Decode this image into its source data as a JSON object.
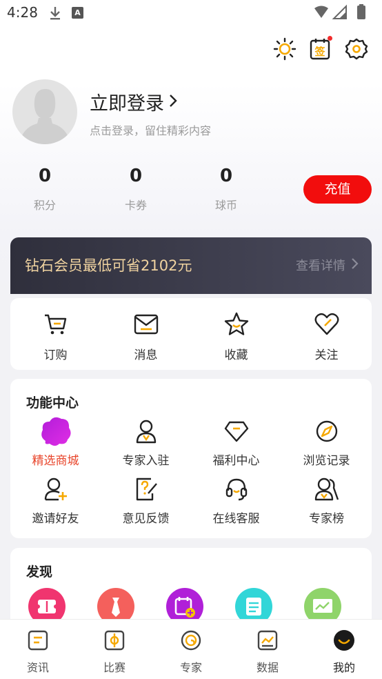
{
  "status_bar": {
    "time": "4:28",
    "a_label": "A"
  },
  "profile": {
    "login_title": "立即登录",
    "login_subtitle": "点击登录，留住精彩内容"
  },
  "sign_icon_label": "签",
  "stats": [
    {
      "value": "0",
      "label": "积分"
    },
    {
      "value": "0",
      "label": "卡券"
    },
    {
      "value": "0",
      "label": "球币"
    }
  ],
  "recharge_label": "充值",
  "vip": {
    "text": "钻石会员最低可省2102元",
    "more": "查看详情"
  },
  "quick_actions": [
    {
      "label": "订购",
      "icon": "cart-icon"
    },
    {
      "label": "消息",
      "icon": "mail-icon"
    },
    {
      "label": "收藏",
      "icon": "star-icon"
    },
    {
      "label": "关注",
      "icon": "heart-icon"
    }
  ],
  "function_center": {
    "title": "功能中心",
    "items": [
      {
        "label": "精选商城",
        "icon": "shop-cloud-icon",
        "highlight": "#e8442a"
      },
      {
        "label": "专家入驻",
        "icon": "expert-icon"
      },
      {
        "label": "福利中心",
        "icon": "diamond-icon"
      },
      {
        "label": "浏览记录",
        "icon": "compass-icon"
      },
      {
        "label": "邀请好友",
        "icon": "add-user-icon"
      },
      {
        "label": "意见反馈",
        "icon": "feedback-icon"
      },
      {
        "label": "在线客服",
        "icon": "headset-icon"
      },
      {
        "label": "专家榜",
        "icon": "ranking-icon"
      }
    ]
  },
  "discover": {
    "title": "发现",
    "items": [
      {
        "icon": "ticket-icon",
        "color": "#f0356f"
      },
      {
        "icon": "tie-icon",
        "color": "#f4605c"
      },
      {
        "icon": "calendar-add-icon",
        "color": "#b020d8"
      },
      {
        "icon": "news-icon",
        "color": "#32d6d8"
      },
      {
        "icon": "chart-board-icon",
        "color": "#8fd46a"
      }
    ]
  },
  "tabs": [
    {
      "label": "资讯",
      "icon": "news-tab-icon"
    },
    {
      "label": "比赛",
      "icon": "match-tab-icon"
    },
    {
      "label": "专家",
      "icon": "expert-tab-icon"
    },
    {
      "label": "数据",
      "icon": "data-tab-icon"
    },
    {
      "label": "我的",
      "icon": "me-tab-icon",
      "active": true
    }
  ],
  "colors": {
    "accent": "#f5a800",
    "recharge": "#f20d0d",
    "vip_text": "#f0d3a0"
  }
}
